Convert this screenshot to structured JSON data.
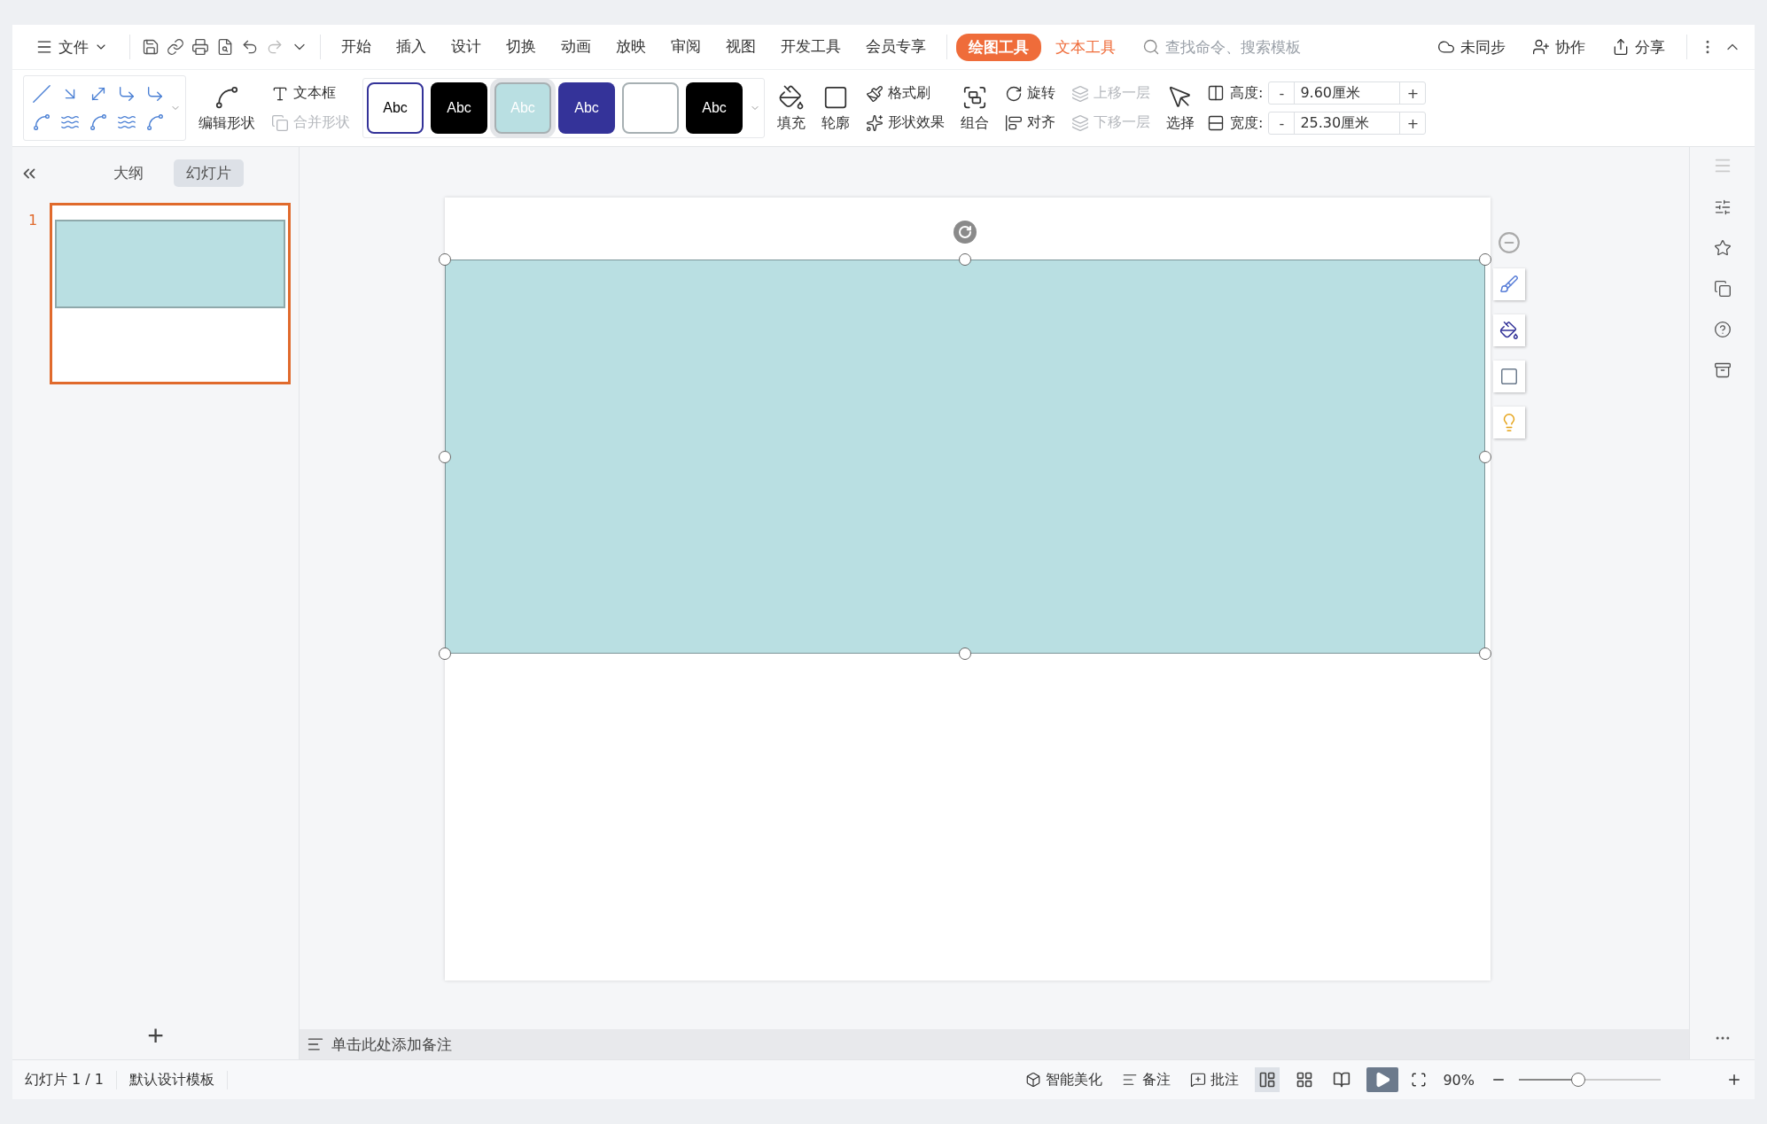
{
  "menu": {
    "file": "文件",
    "tabs": [
      {
        "label": "开始",
        "selected": false
      },
      {
        "label": "插入",
        "selected": false
      },
      {
        "label": "设计",
        "selected": false
      },
      {
        "label": "切换",
        "selected": false
      },
      {
        "label": "动画",
        "selected": false
      },
      {
        "label": "放映",
        "selected": false
      },
      {
        "label": "审阅",
        "selected": false
      },
      {
        "label": "视图",
        "selected": false
      },
      {
        "label": "开发工具",
        "selected": false
      },
      {
        "label": "会员专享",
        "selected": false
      }
    ],
    "tool_tabs": [
      {
        "label": "绘图工具",
        "selected": true
      },
      {
        "label": "文本工具",
        "selected": false
      }
    ],
    "search": {
      "placeholder": "查找命令、搜索模板"
    },
    "actions": [
      {
        "kind": "sync",
        "label": "未同步"
      },
      {
        "kind": "collab",
        "label": "协作"
      },
      {
        "kind": "share",
        "label": "分享"
      }
    ]
  },
  "ribbon": {
    "edit_shape": "编辑形状",
    "text_box": "文本框",
    "merge_shapes": {
      "label": "合并形状",
      "disabled": true
    },
    "styles": [
      {
        "label": "Abc",
        "color": "#ffffff",
        "selected": false
      },
      {
        "label": "Abc",
        "color": "#000000",
        "selected": false
      },
      {
        "label": "Abc",
        "color": "#b9dfe2",
        "selected": true
      },
      {
        "label": "Abc",
        "color": "#343399",
        "selected": false
      },
      {
        "color": "#ffffff",
        "selected": false
      },
      {
        "label": "Abc",
        "color": "#000000",
        "selected": false
      }
    ],
    "fill": "填充",
    "outline": "轮廓",
    "format_painter": "格式刷",
    "shape_effects": "形状效果",
    "group": "组合",
    "rotate": "旋转",
    "align": "对齐",
    "bring_forward": {
      "label": "上移一层",
      "disabled": true
    },
    "send_backward": {
      "label": "下移一层",
      "disabled": true
    },
    "select": "选择",
    "size": [
      {
        "kind": "height",
        "label": "高度:",
        "value": "9.60厘米",
        "minus": "-",
        "plus": "+"
      },
      {
        "kind": "width",
        "label": "宽度:",
        "value": "25.30厘米",
        "minus": "-",
        "plus": "+"
      }
    ]
  },
  "sidebar": {
    "tabs": [
      {
        "label": "大纲",
        "selected": false
      },
      {
        "label": "幻灯片",
        "selected": true
      }
    ],
    "slides": [
      {
        "number": "1",
        "selected": true
      }
    ],
    "add": "+"
  },
  "notes": {
    "placeholder": "单击此处添加备注"
  },
  "status_bar": {
    "slide": "幻灯片 1 / 1",
    "template": "默认设计模板",
    "beautify": "智能美化",
    "notes": "备注",
    "comments": "批注",
    "zoom": "90%",
    "zoom_slider": {
      "level": 0.42
    }
  }
}
